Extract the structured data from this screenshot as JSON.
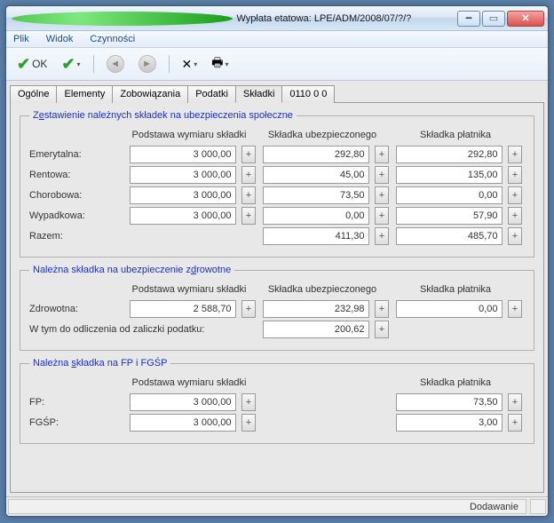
{
  "window": {
    "title": "Wypłata etatowa: LPE/ADM/2008/07/?/?"
  },
  "menu": {
    "file": "Plik",
    "view": "Widok",
    "actions": "Czynności"
  },
  "toolbar": {
    "ok": "OK"
  },
  "tabs": [
    "Ogólne",
    "Elementy",
    "Zobowiązania",
    "Podatki",
    "Składki",
    "0110 0 0"
  ],
  "section1": {
    "legend_pre": "Z",
    "legend_u": "e",
    "legend_post": "stawienie należnych składek na ubezpieczenia społeczne",
    "h1": "Podstawa wymiaru składki",
    "h2": "Składka ubezpieczonego",
    "h3": "Składka płatnika",
    "rows": [
      {
        "label": "Emerytalna:",
        "v1": "3 000,00",
        "v2": "292,80",
        "v3": "292,80"
      },
      {
        "label": "Rentowa:",
        "v1": "3 000,00",
        "v2": "45,00",
        "v3": "135,00"
      },
      {
        "label": "Chorobowa:",
        "v1": "3 000,00",
        "v2": "73,50",
        "v3": "0,00"
      },
      {
        "label": "Wypadkowa:",
        "v1": "3 000,00",
        "v2": "0,00",
        "v3": "57,90"
      },
      {
        "label": "Razem:",
        "v1": "",
        "v2": "411,30",
        "v3": "485,70"
      }
    ]
  },
  "section2": {
    "legend_pre": "Należna składka na ubezpieczenie z",
    "legend_u": "d",
    "legend_post": "rowotne",
    "h1": "Podstawa wymiaru składki",
    "h2": "Składka ubezpieczonego",
    "h3": "Składka płatnika",
    "row": {
      "label": "Zdrowotna:",
      "v1": "2 588,70",
      "v2": "232,98",
      "v3": "0,00"
    },
    "deduct_label": "W tym do odliczenia od zaliczki podatku:",
    "deduct_value": "200,62"
  },
  "section3": {
    "legend_pre": "Należna ",
    "legend_u": "s",
    "legend_post": "kładka na FP i FGŚP",
    "h1": "Podstawa wymiaru składki",
    "h3": "Składka płatnika",
    "rows": [
      {
        "label": "FP:",
        "v1": "3 000,00",
        "v3": "73,50"
      },
      {
        "label": "FGŚP:",
        "v1": "3 000,00",
        "v3": "3,00"
      }
    ]
  },
  "status": {
    "mode": "Dodawanie"
  }
}
